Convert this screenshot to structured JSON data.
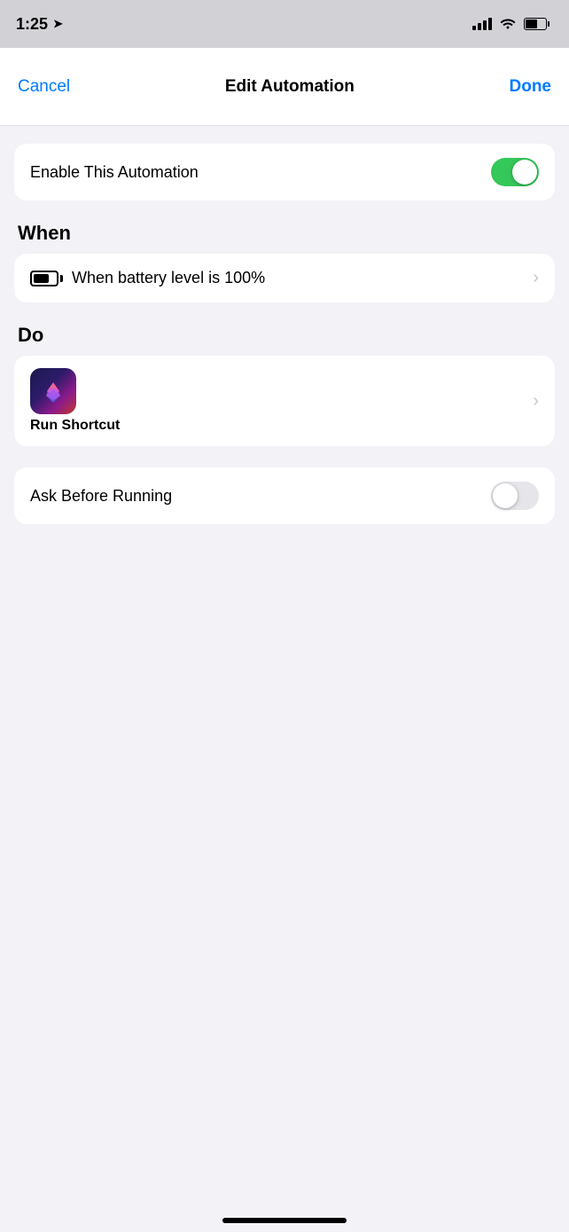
{
  "statusBar": {
    "time": "1:25",
    "locationArrow": "➤"
  },
  "navBar": {
    "cancelLabel": "Cancel",
    "title": "Edit Automation",
    "doneLabel": "Done"
  },
  "enableToggle": {
    "label": "Enable This Automation",
    "enabled": true
  },
  "whenSection": {
    "heading": "When",
    "trigger": {
      "label": "When battery level is 100%"
    }
  },
  "doSection": {
    "heading": "Do",
    "action": {
      "title": "Run Shortcut"
    }
  },
  "askBeforeRunning": {
    "label": "Ask Before Running",
    "enabled": false
  }
}
